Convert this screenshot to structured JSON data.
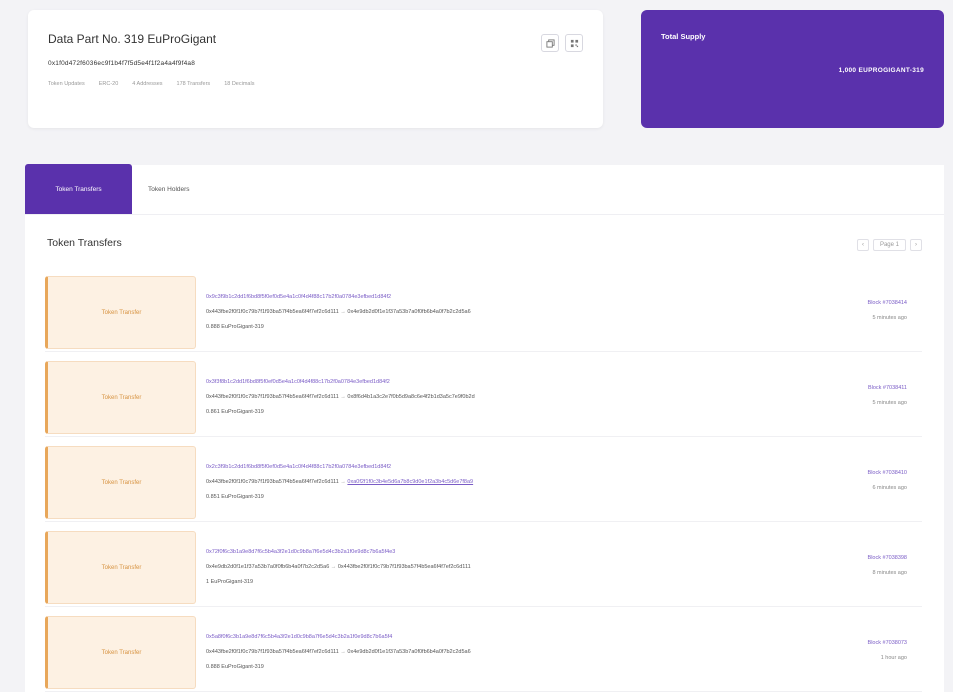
{
  "token": {
    "title": "Data Part No. 319 EuProGigant",
    "address": "0x1f0d472f6036ec9f1b4f7f5d5e4f1f2a4a4f9f4a8",
    "meta": [
      "Token Updates",
      "ERC-20",
      "4 Addresses",
      "178 Transfers",
      "18 Decimals"
    ]
  },
  "supply": {
    "label": "Total Supply",
    "value": "1,000 EUPROGIGANT-319"
  },
  "tabs": {
    "transfers": "Token Transfers",
    "holders": "Token Holders"
  },
  "section": {
    "title": "Token Transfers",
    "page_label": "Page 1"
  },
  "transfers": [
    {
      "badge": "Token Transfer",
      "hash": "0x9c3f9b1c2dd1f6bd8f5f0ef0d5e4a1c0f4d4f88c17b2f0a0784e3efbed1d84f2",
      "from": "0x443fbe2f0f1f0c79b7f1f93ba57f4b5ea6f4f7ef2c6d111",
      "to": "0x4e9db2d0f1e1f37a53b7a0f0fb6b4a0f7b2c2d5a6",
      "to_link": false,
      "amount": "0.888 EuProGigant-319",
      "block": "Block #7038414",
      "ago": "5 minutes ago"
    },
    {
      "badge": "Token Transfer",
      "hash": "0x3f3f8b1c2dd1f6bd8f5f0ef0d5e4a1c0f4d4f88c17b2f0a0784e3efbed1d84f2",
      "from": "0x443fbe2f0f1f0c79b7f1f93ba57f4b5ea6f4f7ef2c6d111",
      "to": "0x8f6d4b1a3c2e7f0b5d9a8c6e4f2b1d3a5c7e9f0b2d",
      "to_link": false,
      "amount": "0.861 EuProGigant-319",
      "block": "Block #7038411",
      "ago": "5 minutes ago"
    },
    {
      "badge": "Token Transfer",
      "hash": "0x2c3f9b1c2dd1f6bd8f5f0ef0d5e4a1c0f4d4f88c17b2f0a0784e3efbed1d84f2",
      "from": "0x443fbe2f0f1f0c79b7f1f93ba57f4b5ea6f4f7ef2c6d111",
      "to": "0xa0f2f1f0c3b4e5d6a7b8c9d0e1f2a3b4c5d6e7f8a9",
      "to_link": true,
      "amount": "0.851 EuProGigant-319",
      "block": "Block #7038410",
      "ago": "6 minutes ago"
    },
    {
      "badge": "Token Transfer",
      "hash": "0x72f0f6c3b1a9e8d7f6c5b4a3f2e1d0c9b8a7f6e5d4c3b2a1f0e9d8c7b6a5f4e3",
      "from": "0x4e9db2d0f1e1f37a53b7a0f0fb6b4a0f7b2c2d5a6",
      "to": "0x443fbe2f0f1f0c79b7f1f93ba57f4b5ea6f4f7ef2c6d111",
      "to_link": false,
      "amount": "1 EuProGigant-319",
      "block": "Block #7038398",
      "ago": "8 minutes ago"
    },
    {
      "badge": "Token Transfer",
      "hash": "0x5a8f0f6c3b1a9e8d7f6c5b4a3f2e1d0c9b8a7f6e5d4c3b2a1f0e9d8c7b6a5f4",
      "from": "0x443fbe2f0f1f0c79b7f1f93ba57f4b5ea6f4f7ef2c6d111",
      "to": "0x4e9db2d0f1e1f37a53b7a0f0fb6b4a0f7b2c2d5a6",
      "to_link": false,
      "amount": "0.888 EuProGigant-319",
      "block": "Block #7038073",
      "ago": "1 hour ago"
    }
  ],
  "icons": {
    "copy": "copy-icon",
    "qr": "qr-code-icon",
    "prev": "chevron-left-icon",
    "next": "chevron-right-icon"
  },
  "colors": {
    "accent": "#5a31ac",
    "badge_bg": "#fdf1e3",
    "badge_border": "#e8a75a",
    "link": "#7a5cc6"
  }
}
